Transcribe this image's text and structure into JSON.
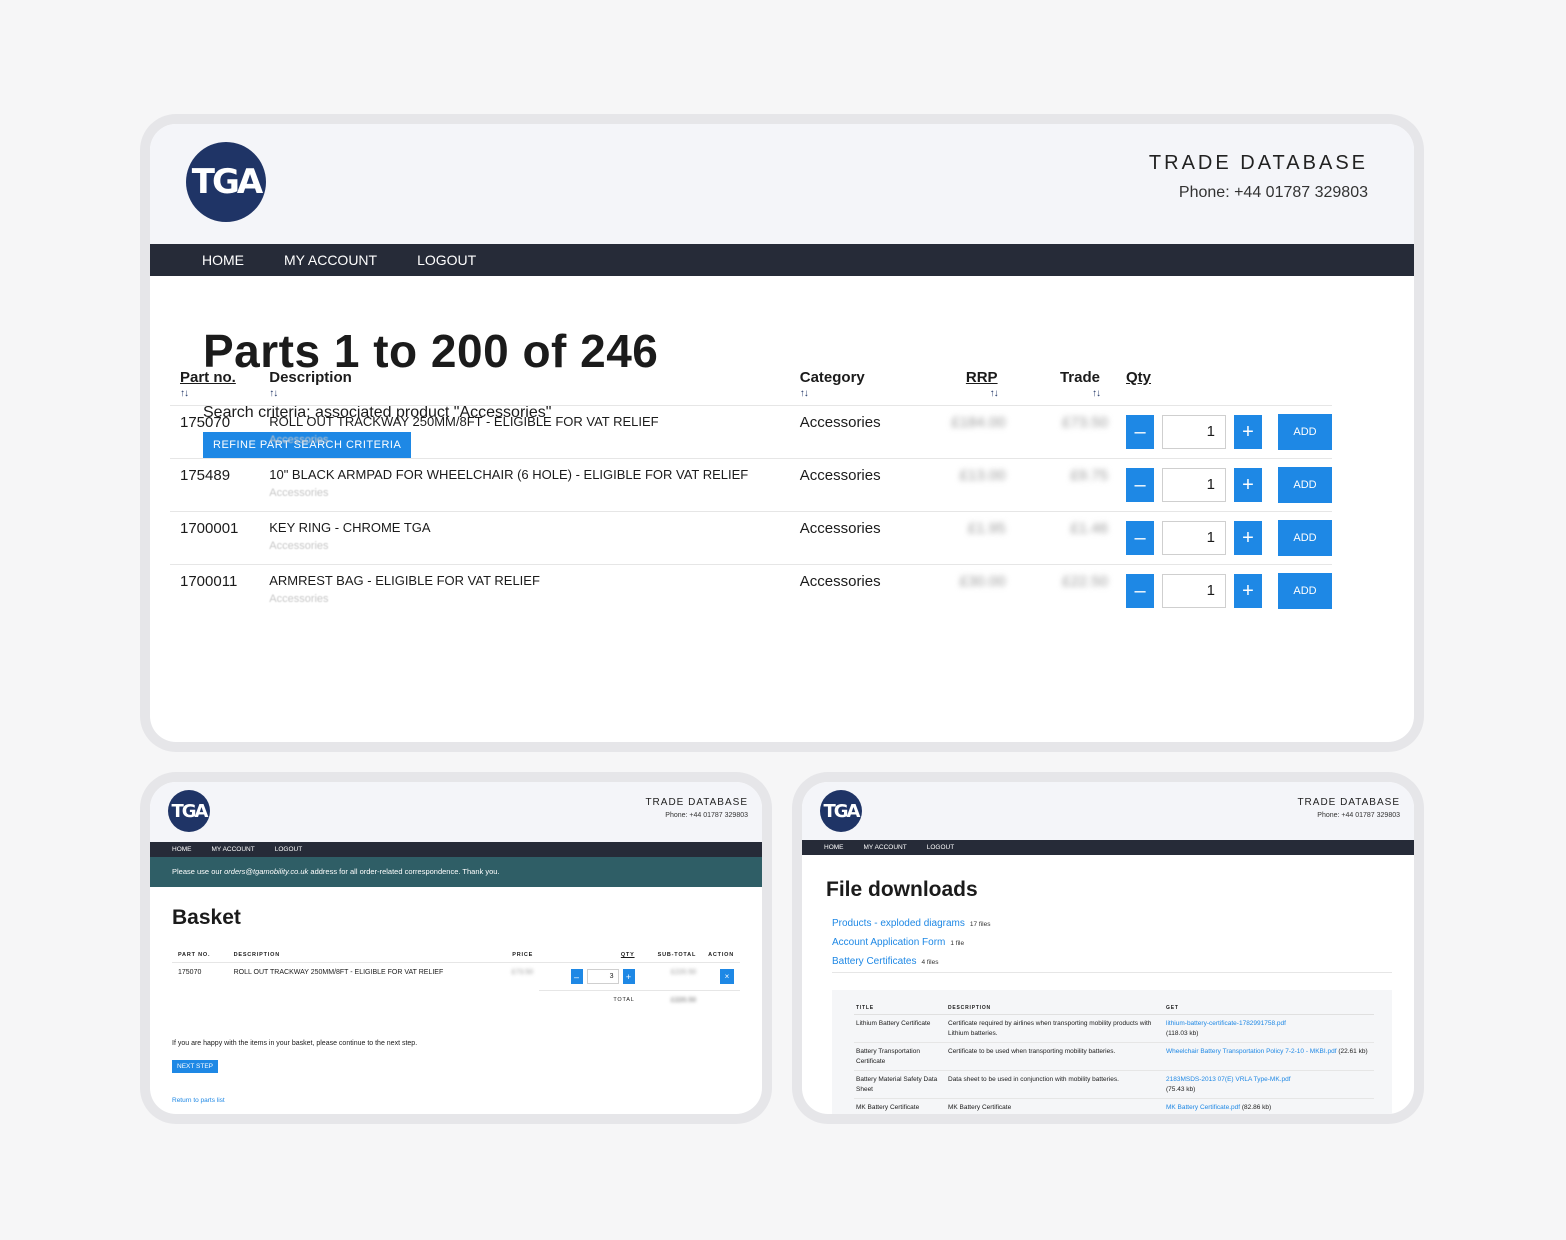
{
  "site": {
    "logo_text": "TGA",
    "brand_title": "TRADE DATABASE",
    "phone": "Phone: +44 01787 329803",
    "nav": [
      "HOME",
      "MY ACCOUNT",
      "LOGOUT"
    ]
  },
  "parts_page": {
    "title": "Parts 1 to 200 of 246",
    "criteria": "Search criteria; associated product \"Accessories\"",
    "refine_button": "REFINE PART SEARCH CRITERIA",
    "columns": {
      "part_no": "Part no.",
      "description": "Description",
      "category": "Category",
      "rrp": "RRP",
      "trade": "Trade",
      "qty": "Qty"
    },
    "sort_icon": "↑↓",
    "rows": [
      {
        "part_no": "175070",
        "description": "ROLL OUT TRACKWAY 250MM/8FT - ELIGIBLE FOR VAT RELIEF",
        "sub": "Accessories",
        "category": "Accessories",
        "rrp": "£184.00",
        "trade": "£73.50",
        "qty": "1"
      },
      {
        "part_no": "175489",
        "description": "10\" BLACK ARMPAD FOR WHEELCHAIR (6 HOLE) - ELIGIBLE FOR VAT RELIEF",
        "sub": "Accessories",
        "category": "Accessories",
        "rrp": "£13.00",
        "trade": "£9.75",
        "qty": "1"
      },
      {
        "part_no": "1700001",
        "description": "KEY RING - CHROME TGA",
        "sub": "Accessories",
        "category": "Accessories",
        "rrp": "£1.95",
        "trade": "£1.46",
        "qty": "1"
      },
      {
        "part_no": "1700011",
        "description": "ARMREST BAG - ELIGIBLE FOR VAT RELIEF",
        "sub": "Accessories",
        "category": "Accessories",
        "rrp": "£30.00",
        "trade": "£22.50",
        "qty": "1"
      }
    ],
    "minus_label": "–",
    "plus_label": "+",
    "add_label": "ADD"
  },
  "basket_page": {
    "notice_prefix": "Please use our ",
    "notice_email": "orders@tgamobility.co.uk",
    "notice_suffix": " address for all order-related correspondence. Thank you.",
    "title": "Basket",
    "columns": [
      "PART NO.",
      "DESCRIPTION",
      "PRICE",
      "QTY",
      "SUB-TOTAL",
      "ACTION"
    ],
    "item": {
      "part_no": "175070",
      "description": "ROLL OUT TRACKWAY 250MM/8FT - ELIGIBLE FOR VAT RELIEF",
      "price": "£73.50",
      "qty": "3",
      "subtotal": "£220.50"
    },
    "total_label": "TOTAL",
    "total_value": "£220.50",
    "remove_label": "×",
    "happy_text": "If you are happy with the items in your basket, please continue to the next step.",
    "next_button": "NEXT STEP",
    "return_link": "Return to parts list"
  },
  "files_page": {
    "title": "File downloads",
    "groups": [
      {
        "label": "Products - exploded diagrams",
        "count": "17 files"
      },
      {
        "label": "Account Application Form",
        "count": "1 file"
      },
      {
        "label": "Battery Certificates",
        "count": "4 files"
      }
    ],
    "columns": [
      "TITLE",
      "DESCRIPTION",
      "GET"
    ],
    "rows": [
      {
        "title": "Lithium Battery Certificate",
        "description": "Certificate required by airlines when transporting mobility products with Lithium batteries.",
        "file": "lithium-battery-certificate-1782991758.pdf",
        "size": "(118.03 kb)"
      },
      {
        "title": "Battery Transportation Certificate",
        "description": "Certificate to be used when transporting mobility batteries.",
        "file": "Wheelchair Battery Transportation Policy 7-2-10 - MKBI.pdf",
        "size": "(22.61 kb)"
      },
      {
        "title": "Battery Material Safety Data Sheet",
        "description": "Data sheet to be used in conjunction with mobility batteries.",
        "file": "2183MSDS-2013 07(E) VRLA Type-MK.pdf",
        "size": "(75.43 kb)"
      },
      {
        "title": "MK Battery Certificate",
        "description": "MK Battery Certificate",
        "file": "MK Battery Certificate.pdf",
        "size": "(82.86 kb)"
      }
    ]
  }
}
